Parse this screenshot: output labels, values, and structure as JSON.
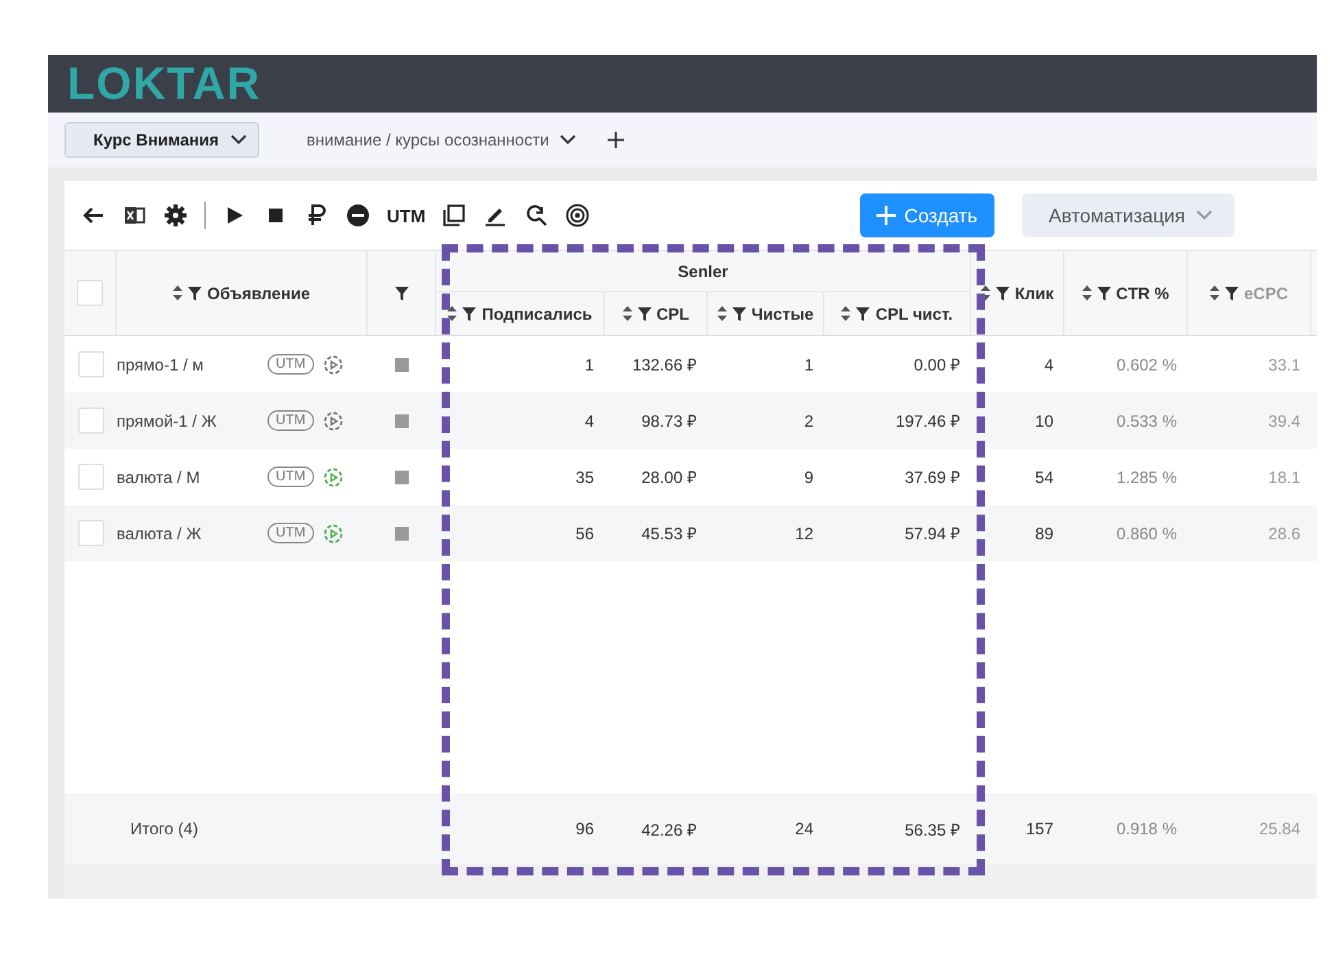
{
  "logo": "LOKTAR",
  "tabs": [
    {
      "label": "Курс Внимания",
      "selected": true
    },
    {
      "label": "внимание / курсы осознанности",
      "selected": false
    }
  ],
  "toolbar": {
    "utm_label": "UTM",
    "create_button": "Создать",
    "automation_button": "Автоматизация"
  },
  "table": {
    "select_all_checked": false,
    "group_header": "Senler",
    "name_column": "Объявление",
    "group_columns": [
      "Подписались",
      "CPL",
      "Чистые",
      "CPL чист."
    ],
    "columns": [
      "Клик",
      "CTR %",
      "eCPC"
    ],
    "rows": [
      {
        "name": "прямо-1 / м",
        "utm": "UTM",
        "checked": false,
        "active": false,
        "values": [
          "1",
          "132.66 ₽",
          "1",
          "0.00 ₽",
          "4",
          "0.602 %",
          "33.1"
        ]
      },
      {
        "name": "прямой-1 / Ж",
        "utm": "UTM",
        "checked": false,
        "active": false,
        "values": [
          "4",
          "98.73 ₽",
          "2",
          "197.46 ₽",
          "10",
          "0.533 %",
          "39.4"
        ]
      },
      {
        "name": "валюта / М",
        "utm": "UTM",
        "checked": false,
        "active": true,
        "values": [
          "35",
          "28.00 ₽",
          "9",
          "37.69 ₽",
          "54",
          "1.285 %",
          "18.1"
        ]
      },
      {
        "name": "валюта / Ж",
        "utm": "UTM",
        "checked": false,
        "active": true,
        "values": [
          "56",
          "45.53 ₽",
          "12",
          "57.94 ₽",
          "89",
          "0.860 %",
          "28.6"
        ]
      }
    ],
    "total": {
      "label": "Итого (4)",
      "values": [
        "96",
        "42.26 ₽",
        "24",
        "56.35 ₽",
        "157",
        "0.918 %",
        "25.84"
      ]
    }
  }
}
